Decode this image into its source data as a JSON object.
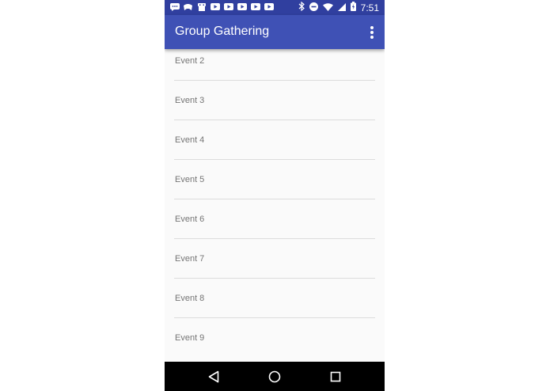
{
  "app": {
    "title": "Group Gathering"
  },
  "status_bar": {
    "time": "7:51",
    "notification_icons": [
      "chat-bubble-icon",
      "game-controller-icon",
      "android-robot-icon",
      "youtube-icon",
      "youtube-icon",
      "youtube-icon",
      "youtube-icon",
      "youtube-icon"
    ],
    "system_icons": [
      "bluetooth-icon",
      "do-not-disturb-icon",
      "wifi-icon",
      "cellular-signal-icon",
      "battery-charging-icon"
    ]
  },
  "events": [
    {
      "label": "Event 2"
    },
    {
      "label": "Event 3"
    },
    {
      "label": "Event 4"
    },
    {
      "label": "Event 5"
    },
    {
      "label": "Event 6"
    },
    {
      "label": "Event 7"
    },
    {
      "label": "Event 8"
    },
    {
      "label": "Event 9"
    }
  ],
  "nav": {
    "buttons": [
      "back-icon",
      "home-icon",
      "recents-icon"
    ]
  },
  "colors": {
    "primary": "#3f51b5",
    "primary_dark": "#303f9f",
    "background": "#fafafa",
    "divider": "#dcdcdc",
    "item_text": "#757575"
  }
}
